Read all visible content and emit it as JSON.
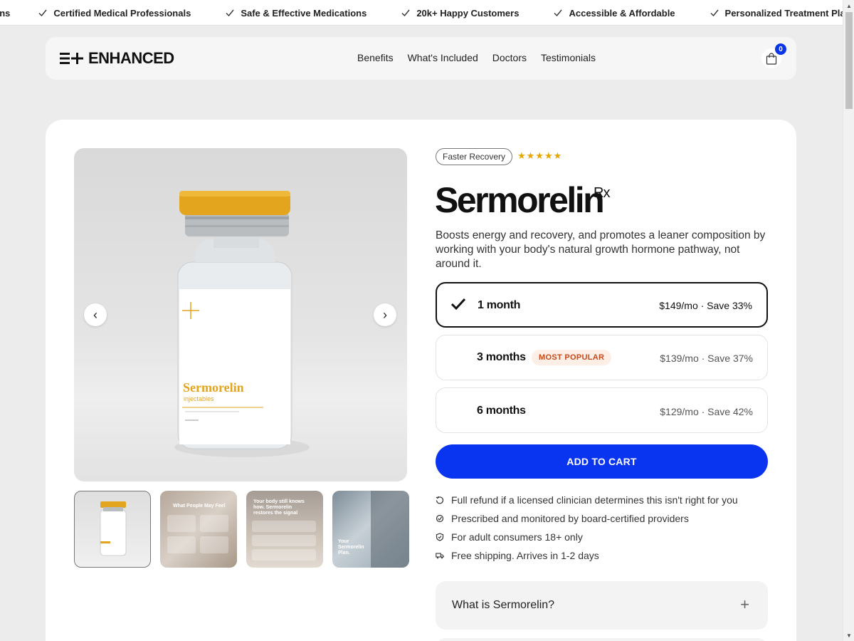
{
  "marquee": {
    "items": [
      "ans",
      "Certified Medical Professionals",
      "Safe & Effective Medications",
      "20k+ Happy Customers",
      "Accessible & Affordable",
      "Personalized Treatment Pla"
    ]
  },
  "header": {
    "logo_text": "ENHANCED",
    "nav": [
      "Benefits",
      "What's Included",
      "Doctors",
      "Testimonials"
    ],
    "cart_count": "0"
  },
  "gallery": {
    "prev_icon": "‹",
    "next_icon": "›",
    "vial_name": "Sermorelin",
    "vial_sub": "injectables",
    "thumb2_title": "What People May Feel",
    "thumb3_title": "Your body still knows how. Sermorelin restores the signal",
    "thumb4_title": "Your Sermorelin Plan."
  },
  "product": {
    "tag": "Faster Recovery",
    "stars": "★★★★★",
    "name": "Sermorelin",
    "rx": "Rx",
    "description": "Boosts energy and recovery, and promotes a leaner composition by working with your body's natural growth hormone pathway, not around it."
  },
  "plans": [
    {
      "length": "1 month",
      "price": "$149/mo · Save 33%",
      "badge": "",
      "selected": true
    },
    {
      "length": "3 months",
      "price": "$139/mo · Save 37%",
      "badge": "MOST POPULAR",
      "selected": false
    },
    {
      "length": "6 months",
      "price": "$129/mo · Save 42%",
      "badge": "",
      "selected": false
    }
  ],
  "cta_label": "ADD TO CART",
  "guarantees": [
    {
      "icon": "refund-icon",
      "text": "Full refund if a licensed clinician determines this isn't right for you"
    },
    {
      "icon": "provider-icon",
      "text": "Prescribed and monitored by board-certified providers"
    },
    {
      "icon": "shield-icon",
      "text": "For adult consumers 18+ only"
    },
    {
      "icon": "truck-icon",
      "text": "Free shipping. Arrives in 1-2 days"
    }
  ],
  "accordion": {
    "label": "What is Sermorelin?",
    "toggle": "+"
  },
  "colors": {
    "accent": "#0A35F0",
    "star": "#E7A700",
    "badge_bg": "#FDEEE6",
    "badge_text": "#C84A1A"
  }
}
